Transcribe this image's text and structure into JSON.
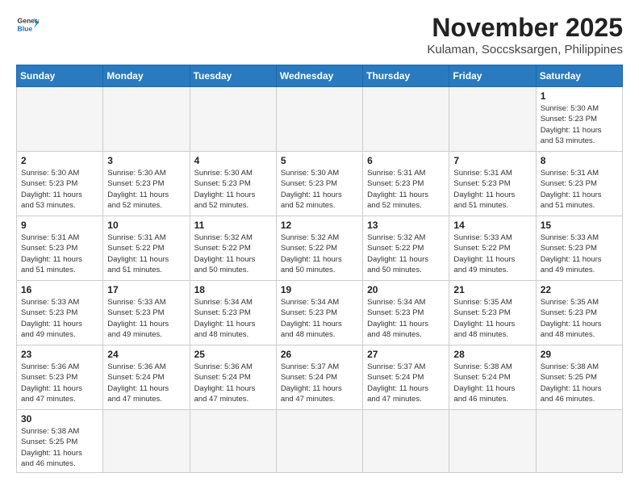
{
  "logo": {
    "line1": "General",
    "line2": "Blue"
  },
  "title": "November 2025",
  "location": "Kulaman, Soccsksargen, Philippines",
  "weekdays": [
    "Sunday",
    "Monday",
    "Tuesday",
    "Wednesday",
    "Thursday",
    "Friday",
    "Saturday"
  ],
  "weeks": [
    [
      {
        "day": null,
        "info": null
      },
      {
        "day": null,
        "info": null
      },
      {
        "day": null,
        "info": null
      },
      {
        "day": null,
        "info": null
      },
      {
        "day": null,
        "info": null
      },
      {
        "day": null,
        "info": null
      },
      {
        "day": "1",
        "info": "Sunrise: 5:30 AM\nSunset: 5:23 PM\nDaylight: 11 hours\nand 53 minutes."
      }
    ],
    [
      {
        "day": "2",
        "info": "Sunrise: 5:30 AM\nSunset: 5:23 PM\nDaylight: 11 hours\nand 53 minutes."
      },
      {
        "day": "3",
        "info": "Sunrise: 5:30 AM\nSunset: 5:23 PM\nDaylight: 11 hours\nand 52 minutes."
      },
      {
        "day": "4",
        "info": "Sunrise: 5:30 AM\nSunset: 5:23 PM\nDaylight: 11 hours\nand 52 minutes."
      },
      {
        "day": "5",
        "info": "Sunrise: 5:30 AM\nSunset: 5:23 PM\nDaylight: 11 hours\nand 52 minutes."
      },
      {
        "day": "6",
        "info": "Sunrise: 5:31 AM\nSunset: 5:23 PM\nDaylight: 11 hours\nand 52 minutes."
      },
      {
        "day": "7",
        "info": "Sunrise: 5:31 AM\nSunset: 5:23 PM\nDaylight: 11 hours\nand 51 minutes."
      },
      {
        "day": "8",
        "info": "Sunrise: 5:31 AM\nSunset: 5:23 PM\nDaylight: 11 hours\nand 51 minutes."
      }
    ],
    [
      {
        "day": "9",
        "info": "Sunrise: 5:31 AM\nSunset: 5:23 PM\nDaylight: 11 hours\nand 51 minutes."
      },
      {
        "day": "10",
        "info": "Sunrise: 5:31 AM\nSunset: 5:22 PM\nDaylight: 11 hours\nand 51 minutes."
      },
      {
        "day": "11",
        "info": "Sunrise: 5:32 AM\nSunset: 5:22 PM\nDaylight: 11 hours\nand 50 minutes."
      },
      {
        "day": "12",
        "info": "Sunrise: 5:32 AM\nSunset: 5:22 PM\nDaylight: 11 hours\nand 50 minutes."
      },
      {
        "day": "13",
        "info": "Sunrise: 5:32 AM\nSunset: 5:22 PM\nDaylight: 11 hours\nand 50 minutes."
      },
      {
        "day": "14",
        "info": "Sunrise: 5:33 AM\nSunset: 5:22 PM\nDaylight: 11 hours\nand 49 minutes."
      },
      {
        "day": "15",
        "info": "Sunrise: 5:33 AM\nSunset: 5:23 PM\nDaylight: 11 hours\nand 49 minutes."
      }
    ],
    [
      {
        "day": "16",
        "info": "Sunrise: 5:33 AM\nSunset: 5:23 PM\nDaylight: 11 hours\nand 49 minutes."
      },
      {
        "day": "17",
        "info": "Sunrise: 5:33 AM\nSunset: 5:23 PM\nDaylight: 11 hours\nand 49 minutes."
      },
      {
        "day": "18",
        "info": "Sunrise: 5:34 AM\nSunset: 5:23 PM\nDaylight: 11 hours\nand 48 minutes."
      },
      {
        "day": "19",
        "info": "Sunrise: 5:34 AM\nSunset: 5:23 PM\nDaylight: 11 hours\nand 48 minutes."
      },
      {
        "day": "20",
        "info": "Sunrise: 5:34 AM\nSunset: 5:23 PM\nDaylight: 11 hours\nand 48 minutes."
      },
      {
        "day": "21",
        "info": "Sunrise: 5:35 AM\nSunset: 5:23 PM\nDaylight: 11 hours\nand 48 minutes."
      },
      {
        "day": "22",
        "info": "Sunrise: 5:35 AM\nSunset: 5:23 PM\nDaylight: 11 hours\nand 48 minutes."
      }
    ],
    [
      {
        "day": "23",
        "info": "Sunrise: 5:36 AM\nSunset: 5:23 PM\nDaylight: 11 hours\nand 47 minutes."
      },
      {
        "day": "24",
        "info": "Sunrise: 5:36 AM\nSunset: 5:24 PM\nDaylight: 11 hours\nand 47 minutes."
      },
      {
        "day": "25",
        "info": "Sunrise: 5:36 AM\nSunset: 5:24 PM\nDaylight: 11 hours\nand 47 minutes."
      },
      {
        "day": "26",
        "info": "Sunrise: 5:37 AM\nSunset: 5:24 PM\nDaylight: 11 hours\nand 47 minutes."
      },
      {
        "day": "27",
        "info": "Sunrise: 5:37 AM\nSunset: 5:24 PM\nDaylight: 11 hours\nand 47 minutes."
      },
      {
        "day": "28",
        "info": "Sunrise: 5:38 AM\nSunset: 5:24 PM\nDaylight: 11 hours\nand 46 minutes."
      },
      {
        "day": "29",
        "info": "Sunrise: 5:38 AM\nSunset: 5:25 PM\nDaylight: 11 hours\nand 46 minutes."
      }
    ],
    [
      {
        "day": "30",
        "info": "Sunrise: 5:38 AM\nSunset: 5:25 PM\nDaylight: 11 hours\nand 46 minutes."
      },
      {
        "day": null,
        "info": null
      },
      {
        "day": null,
        "info": null
      },
      {
        "day": null,
        "info": null
      },
      {
        "day": null,
        "info": null
      },
      {
        "day": null,
        "info": null
      },
      {
        "day": null,
        "info": null
      }
    ]
  ]
}
